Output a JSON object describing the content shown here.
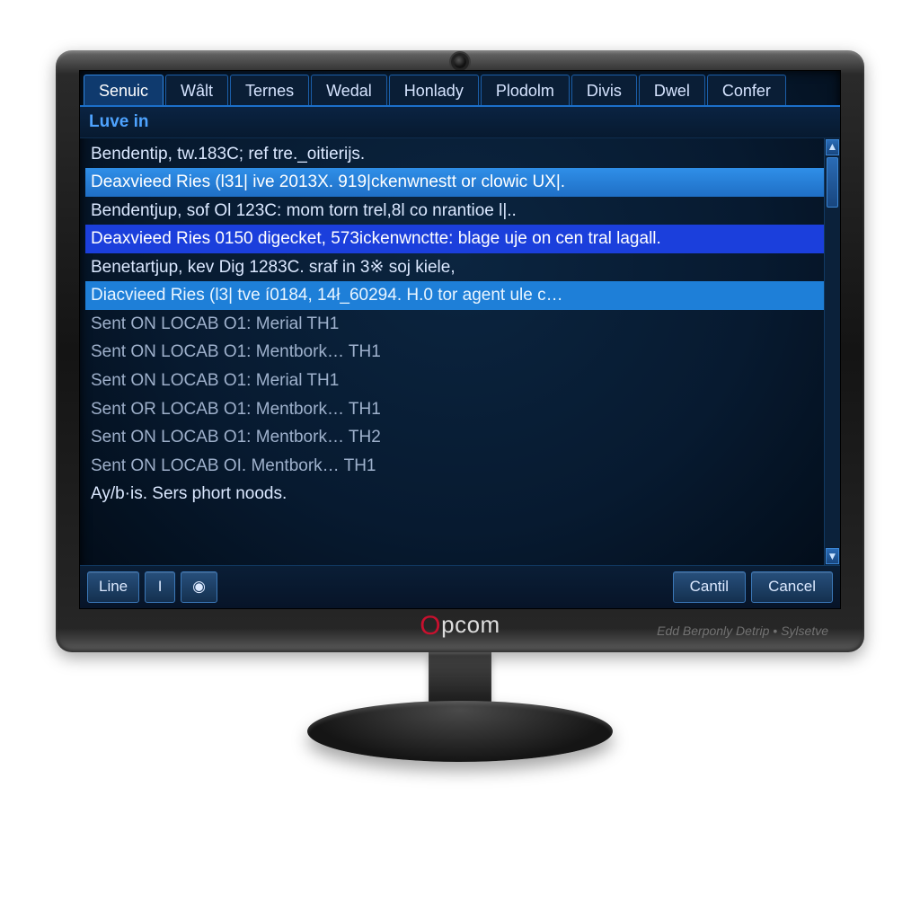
{
  "brand": {
    "name": "pcom",
    "prefix_icon": "O"
  },
  "watermark": "Edd Berponly Detrip • Sylsetve",
  "tabs": [
    {
      "label": "Senuic",
      "active": true
    },
    {
      "label": "Wâlt"
    },
    {
      "label": "Ternes"
    },
    {
      "label": "Wedal"
    },
    {
      "label": "Honlady"
    },
    {
      "label": "Plodolm"
    },
    {
      "label": "Divis"
    },
    {
      "label": "Dwel"
    },
    {
      "label": "Confer"
    }
  ],
  "section_header": "Luve in",
  "rows": [
    {
      "text": "Bendentip, tw.183C; ref tre._oitierijs.",
      "style": ""
    },
    {
      "text": "Deaxvieed Ries (l31| ive 2013X. 919|ckenwnestt or clowic UX|.",
      "style": "hl-light"
    },
    {
      "text": "Bendentjup, sof Ol 123C: mom torn trel,8l co nrantioe l|..",
      "style": ""
    },
    {
      "text": "Deaxvieed Ries 0150 digecket, 573ickenwnctte: blage uje on cen tral lagall.",
      "style": "hl-dark"
    },
    {
      "text": "Benetartjup, kev Dig 1283C. sraf in 3※ soj kiele,",
      "style": ""
    },
    {
      "text": "Diacvieed Ries (l3| tve í0184, 14ł_60294. H.0 tor agent ule c…",
      "style": "hl-cyan"
    },
    {
      "text": "Sent ON LOCAB O1: Merial          TH1",
      "style": "dim"
    },
    {
      "text": "Sent ON LOCAB O1: Mentbork…   TH1",
      "style": "dim"
    },
    {
      "text": "Sent ON LOCAB O1: Merial          TH1",
      "style": "dim"
    },
    {
      "text": "Sent OR LOCAB O1: Mentbork…   TH1",
      "style": "dim"
    },
    {
      "text": "Sent ON LOCAB O1: Mentbork…   TH2",
      "style": "dim"
    },
    {
      "text": "Sent ON LOCAB OI. Mentbork…   TH1",
      "style": "dim"
    },
    {
      "text": "Ay/b·is. Sers phort noods.",
      "style": ""
    }
  ],
  "footer": {
    "line_label": "Line",
    "cursor_label": "I",
    "time_icon": "◉",
    "cantil_label": "Cantil",
    "cancel_label": "Cancel"
  }
}
